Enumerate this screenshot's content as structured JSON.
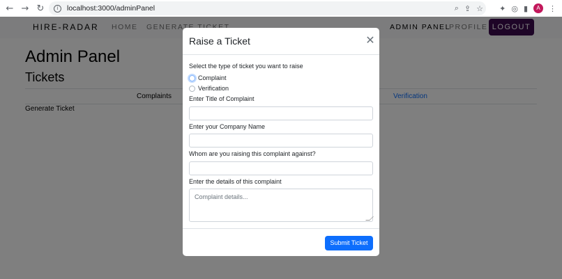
{
  "browser": {
    "url": "localhost:3000/adminPanel",
    "profile_initial": "A"
  },
  "navbar": {
    "brand": "HIRE-RADAR",
    "links": [
      "HOME",
      "GENERATE TICKET",
      "ADMIN PANEL",
      "PROFILE"
    ],
    "logout_label": "LOGOUT",
    "logout_color": "#3d0a4f"
  },
  "page": {
    "title": "Admin Panel",
    "section_title": "Tickets",
    "tabs": [
      "Complaints",
      "Verification"
    ],
    "generate_ticket": "Generate Ticket"
  },
  "modal": {
    "title": "Raise a Ticket",
    "type_prompt": "Select the type of ticket you want to raise",
    "ticket_types": [
      "Complaint",
      "Verification"
    ],
    "selected_type": "Complaint",
    "title_label": "Enter Title of Complaint",
    "title_value": "",
    "company_label": "Enter your Company Name",
    "company_value": "",
    "against_label": "Whom are you raising this complaint against?",
    "against_value": "",
    "details_label": "Enter the details of this complaint",
    "details_placeholder": "Complaint details...",
    "submit_label": "Submit Ticket",
    "submit_color": "#0d6efd"
  }
}
